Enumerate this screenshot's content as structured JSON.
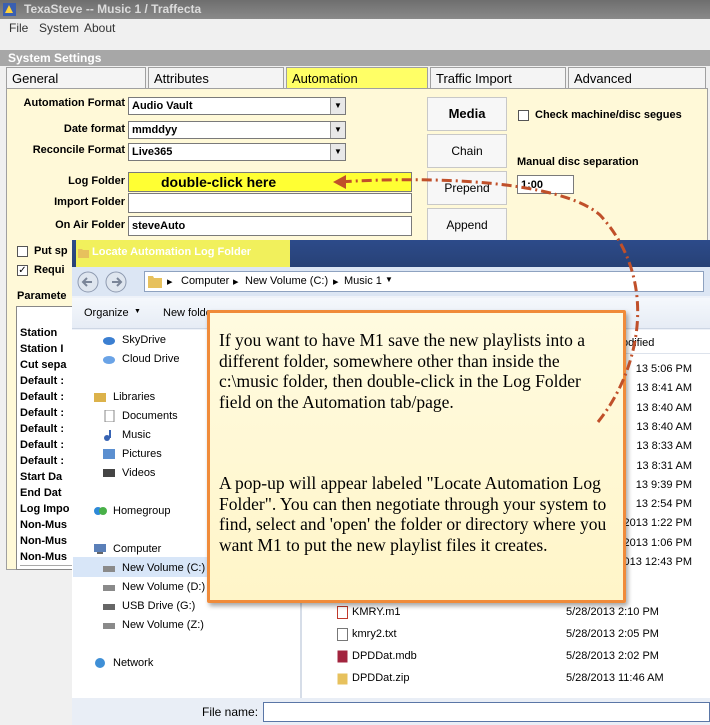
{
  "app": {
    "title": "TexaSteve -- Music 1 / Traffecta"
  },
  "menu": [
    "File",
    "System",
    "About"
  ],
  "system_settings": {
    "header": "System Settings"
  },
  "tabs": [
    "General",
    "Attributes",
    "Automation",
    "Traffic Import",
    "Advanced"
  ],
  "automation": {
    "format_label": "Automation Format",
    "format_value": "Audio Vault",
    "date_label": "Date format",
    "date_value": "mmddyy",
    "reconcile_label": "Reconcile Format",
    "reconcile_value": "Live365",
    "log_label": "Log Folder",
    "log_value": "double-click here",
    "import_label": "Import Folder",
    "import_value": "",
    "onair_label": "On Air Folder",
    "onair_value": "steveAuto",
    "btn_media": "Media",
    "btn_chain": "Chain",
    "btn_prepend": "Prepend",
    "btn_append": "Append",
    "check_segues": "Check machine/disc segues",
    "sep_label": "Manual disc separation",
    "sep_value": "1:00",
    "put_label": "Put sp",
    "req_label": "Requi",
    "params_label": "Paramete"
  },
  "param_rows": [
    "Station",
    "Station I",
    "Cut sepa",
    "Default :",
    "Default :",
    "Default :",
    "Default :",
    "Default :",
    "Default :",
    "Start Da",
    "End Dat",
    "Log Impo",
    "Non-Mus",
    "Non-Mus",
    "Non-Mus"
  ],
  "dialog": {
    "title": "Locate Automation Log Folder",
    "breadcrumb": [
      "Computer",
      "New Volume (C:)",
      "Music 1"
    ],
    "organize": "Organize",
    "new_folder": "New folde",
    "col_modified": "odified",
    "nav": {
      "favorites": [
        "SkyDrive",
        "Cloud Drive"
      ],
      "libraries": "Libraries",
      "library_items": [
        "Documents",
        "Music",
        "Pictures",
        "Videos"
      ],
      "homegroup": "Homegroup",
      "computer": "Computer",
      "drives": [
        "New Volume (C:)",
        "New Volume (D:)",
        "USB Drive (G:)",
        "New Volume (Z:)"
      ],
      "network": "Network"
    },
    "dates_partial": [
      "13 5:06 PM",
      "13 8:41 AM",
      "13 8:40 AM",
      "13 8:40 AM",
      "13 8:33 AM",
      "13 8:31 AM",
      "13 9:39 PM",
      "13 2:54 PM",
      "2013 1:22 PM",
      "2013 1:06 PM",
      "2013 12:43 PM"
    ],
    "files": [
      {
        "name": "KMRY.m1",
        "date": "5/28/2013 2:10 PM"
      },
      {
        "name": "kmry2.txt",
        "date": "5/28/2013 2:05 PM"
      },
      {
        "name": "DPDDat.mdb",
        "date": "5/28/2013 2:02 PM"
      },
      {
        "name": "DPDDat.zip",
        "date": "5/28/2013 11:46 AM"
      }
    ],
    "filename_label": "File name:"
  },
  "callout": {
    "p1": "If you want to have M1 save the new playlists into a different folder, somewhere other than inside the c:\\music folder, then double-click in the Log Folder field on the Automation tab/page.",
    "p2": "A pop-up will appear labeled \"Locate Automation Log Folder\".  You can then negotiate through your system to find, select and 'open' the folder or directory where you want M1 to put the new playlist files it creates."
  },
  "colors": {
    "highlight": "#ffff33",
    "arrow": "#c0502a",
    "callout_border": "#f08b3a",
    "tab_active": "#ffff66"
  }
}
